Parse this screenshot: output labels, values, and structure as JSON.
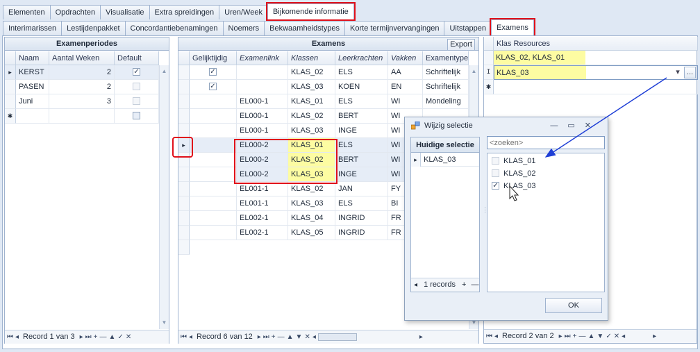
{
  "top_tabs": [
    "Elementen",
    "Opdrachten",
    "Visualisatie",
    "Extra spreidingen",
    "Uren/Week",
    "Bijkomende informatie"
  ],
  "sub_tabs": [
    "Interimarissen",
    "Lestijdenpakket",
    "Concordantiebenamingen",
    "Noemers",
    "Bekwaamheidstypes",
    "Korte termijnvervangingen",
    "Uitstappen",
    "Examens"
  ],
  "examenperiodes": {
    "title": "Examenperiodes",
    "columns": [
      "Naam",
      "Aantal Weken",
      "Default"
    ],
    "rows": [
      {
        "naam": "KERST",
        "weken": "2",
        "default": true
      },
      {
        "naam": "PASEN",
        "weken": "2",
        "default": false
      },
      {
        "naam": "Juni",
        "weken": "3",
        "default": false
      }
    ],
    "record": "Record 1 van 3"
  },
  "examens": {
    "title": "Examens",
    "export_label": "Export",
    "columns": [
      "Gelijktijdig",
      "Examenlink",
      "Klassen",
      "Leerkrachten",
      "Vakken",
      "Examentype"
    ],
    "rows": [
      {
        "gelijk": true,
        "link": "",
        "klas": "KLAS_02",
        "lk": "ELS",
        "vak": "AA",
        "type": "Schriftelijk"
      },
      {
        "gelijk": true,
        "link": "",
        "klas": "KLAS_03",
        "lk": "KOEN",
        "vak": "EN",
        "type": "Schriftelijk"
      },
      {
        "gelijk": false,
        "link": "EL000-1",
        "klas": "KLAS_01",
        "lk": "ELS",
        "vak": "WI",
        "type": "Mondeling"
      },
      {
        "gelijk": false,
        "link": "EL000-1",
        "klas": "KLAS_02",
        "lk": "BERT",
        "vak": "WI",
        "type": ""
      },
      {
        "gelijk": false,
        "link": "EL000-1",
        "klas": "KLAS_03",
        "lk": "INGE",
        "vak": "WI",
        "type": ""
      },
      {
        "gelijk": false,
        "link": "EL000-2",
        "klas": "KLAS_01",
        "lk": "ELS",
        "vak": "WI",
        "type": ""
      },
      {
        "gelijk": false,
        "link": "EL000-2",
        "klas": "KLAS_02",
        "lk": "BERT",
        "vak": "WI",
        "type": ""
      },
      {
        "gelijk": false,
        "link": "EL000-2",
        "klas": "KLAS_03",
        "lk": "INGE",
        "vak": "WI",
        "type": ""
      },
      {
        "gelijk": false,
        "link": "EL001-1",
        "klas": "KLAS_02",
        "lk": "JAN",
        "vak": "FY",
        "type": ""
      },
      {
        "gelijk": false,
        "link": "EL001-1",
        "klas": "KLAS_03",
        "lk": "ELS",
        "vak": "BI",
        "type": ""
      },
      {
        "gelijk": false,
        "link": "EL002-1",
        "klas": "KLAS_04",
        "lk": "INGRID",
        "vak": "FR",
        "type": ""
      },
      {
        "gelijk": false,
        "link": "EL002-1",
        "klas": "KLAS_05",
        "lk": "INGRID",
        "vak": "FR",
        "type": ""
      }
    ],
    "record": "Record 6 van 12"
  },
  "klas_resources": {
    "column": "Klas Resources",
    "rows": [
      "KLAS_02, KLAS_01",
      "KLAS_03"
    ],
    "edit_button": "...",
    "record": "Record 2 van 2"
  },
  "dialog": {
    "title": "Wijzig selectie",
    "current_header": "Huidige selectie",
    "current_items": [
      "KLAS_03"
    ],
    "current_record": "1 records",
    "search_placeholder": "<zoeken>",
    "options": [
      {
        "label": "KLAS_01",
        "checked": false
      },
      {
        "label": "KLAS_02",
        "checked": false
      },
      {
        "label": "KLAS_03",
        "checked": true
      }
    ],
    "ok_label": "OK"
  },
  "glyphs": {
    "row_indicator": "▸",
    "new_row": "✱",
    "check": "✓",
    "dropdown": "▾",
    "minimize": "—",
    "maximize": "▭",
    "close": "✕",
    "nav_left": "◂",
    "nav_right": "▸",
    "nav_plus": "+",
    "nav_minus": "—"
  },
  "colors": {
    "highlight": "#fdfca2",
    "annotation_red": "#e0101a",
    "arrow_blue": "#1f3fd6"
  }
}
